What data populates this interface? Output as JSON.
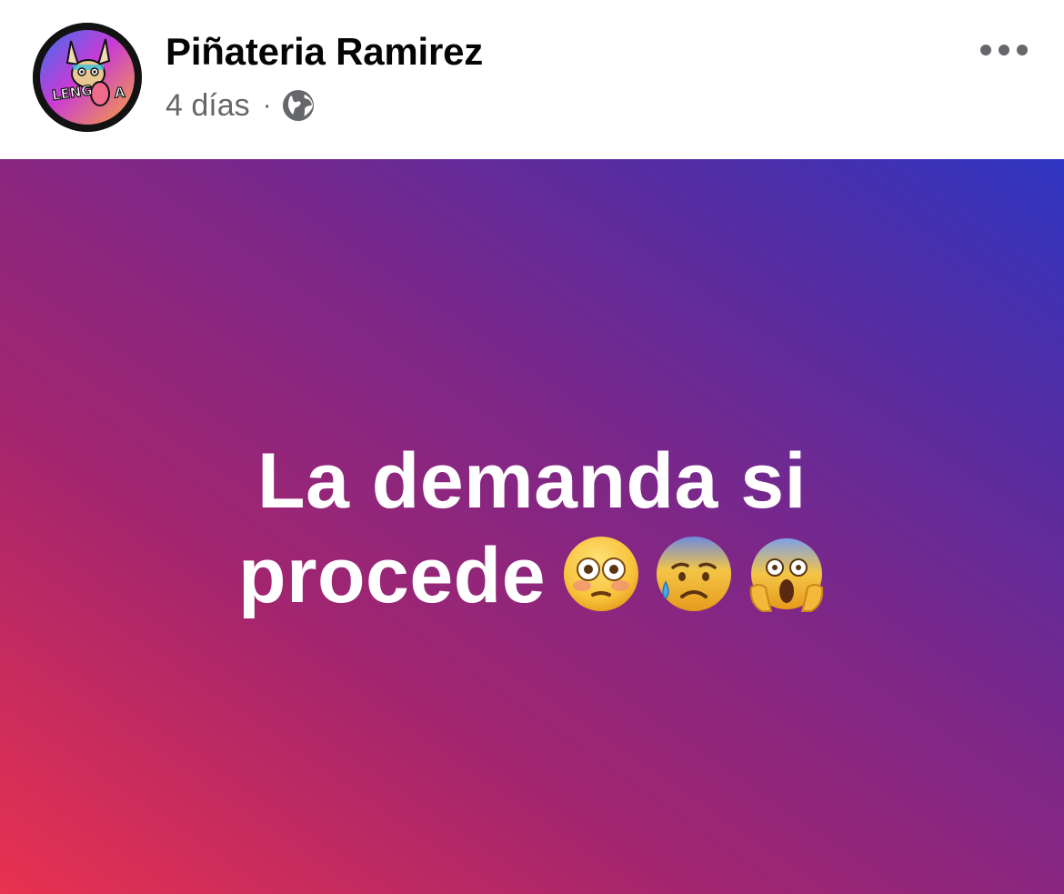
{
  "post": {
    "author": "Piñateria Ramirez",
    "avatar_text": "LENGUA",
    "timestamp": "4 días",
    "separator": "·",
    "privacy_icon": "globe-icon",
    "menu_icon": "more-horizontal-icon",
    "status_line_1": "La demanda si",
    "status_line_2": "procede",
    "emojis": [
      "flushed-face",
      "anxious-face-with-sweat",
      "face-screaming-in-fear"
    ],
    "background_gradient": [
      "#e8324f",
      "#a4256e",
      "#7d2788",
      "#4c2ea8",
      "#2f36c2"
    ]
  }
}
